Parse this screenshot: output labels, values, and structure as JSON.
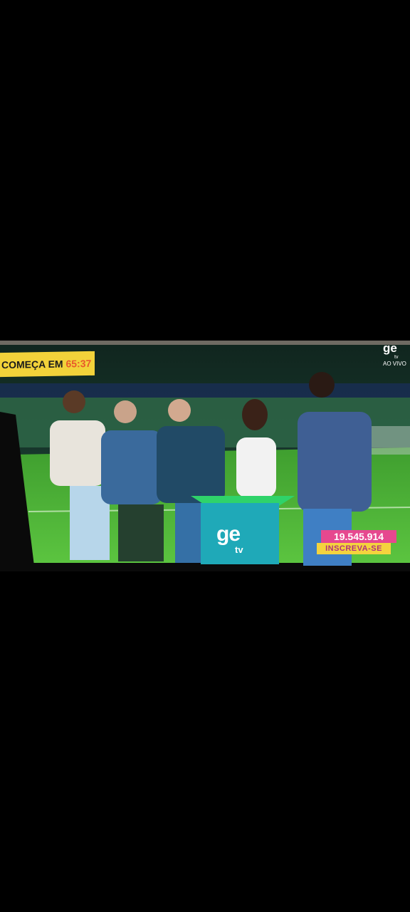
{
  "overlay": {
    "countdown_prefix": "COMEÇA EM",
    "countdown_time": "65:37",
    "channel_logo": "ge",
    "channel_logo_sub": "tv",
    "live_label": "AO VIVO",
    "podium_logo": "ge",
    "podium_logo_sub": "tv",
    "subscriber_count": "19.545.914",
    "subscribe_label": "INSCREVA-SE"
  },
  "colors": {
    "banner_yellow": "#f2d23a",
    "countdown_orange": "#e85a2a",
    "subscriber_pink": "#e6488f",
    "pitch_green": "#4fb83a"
  }
}
